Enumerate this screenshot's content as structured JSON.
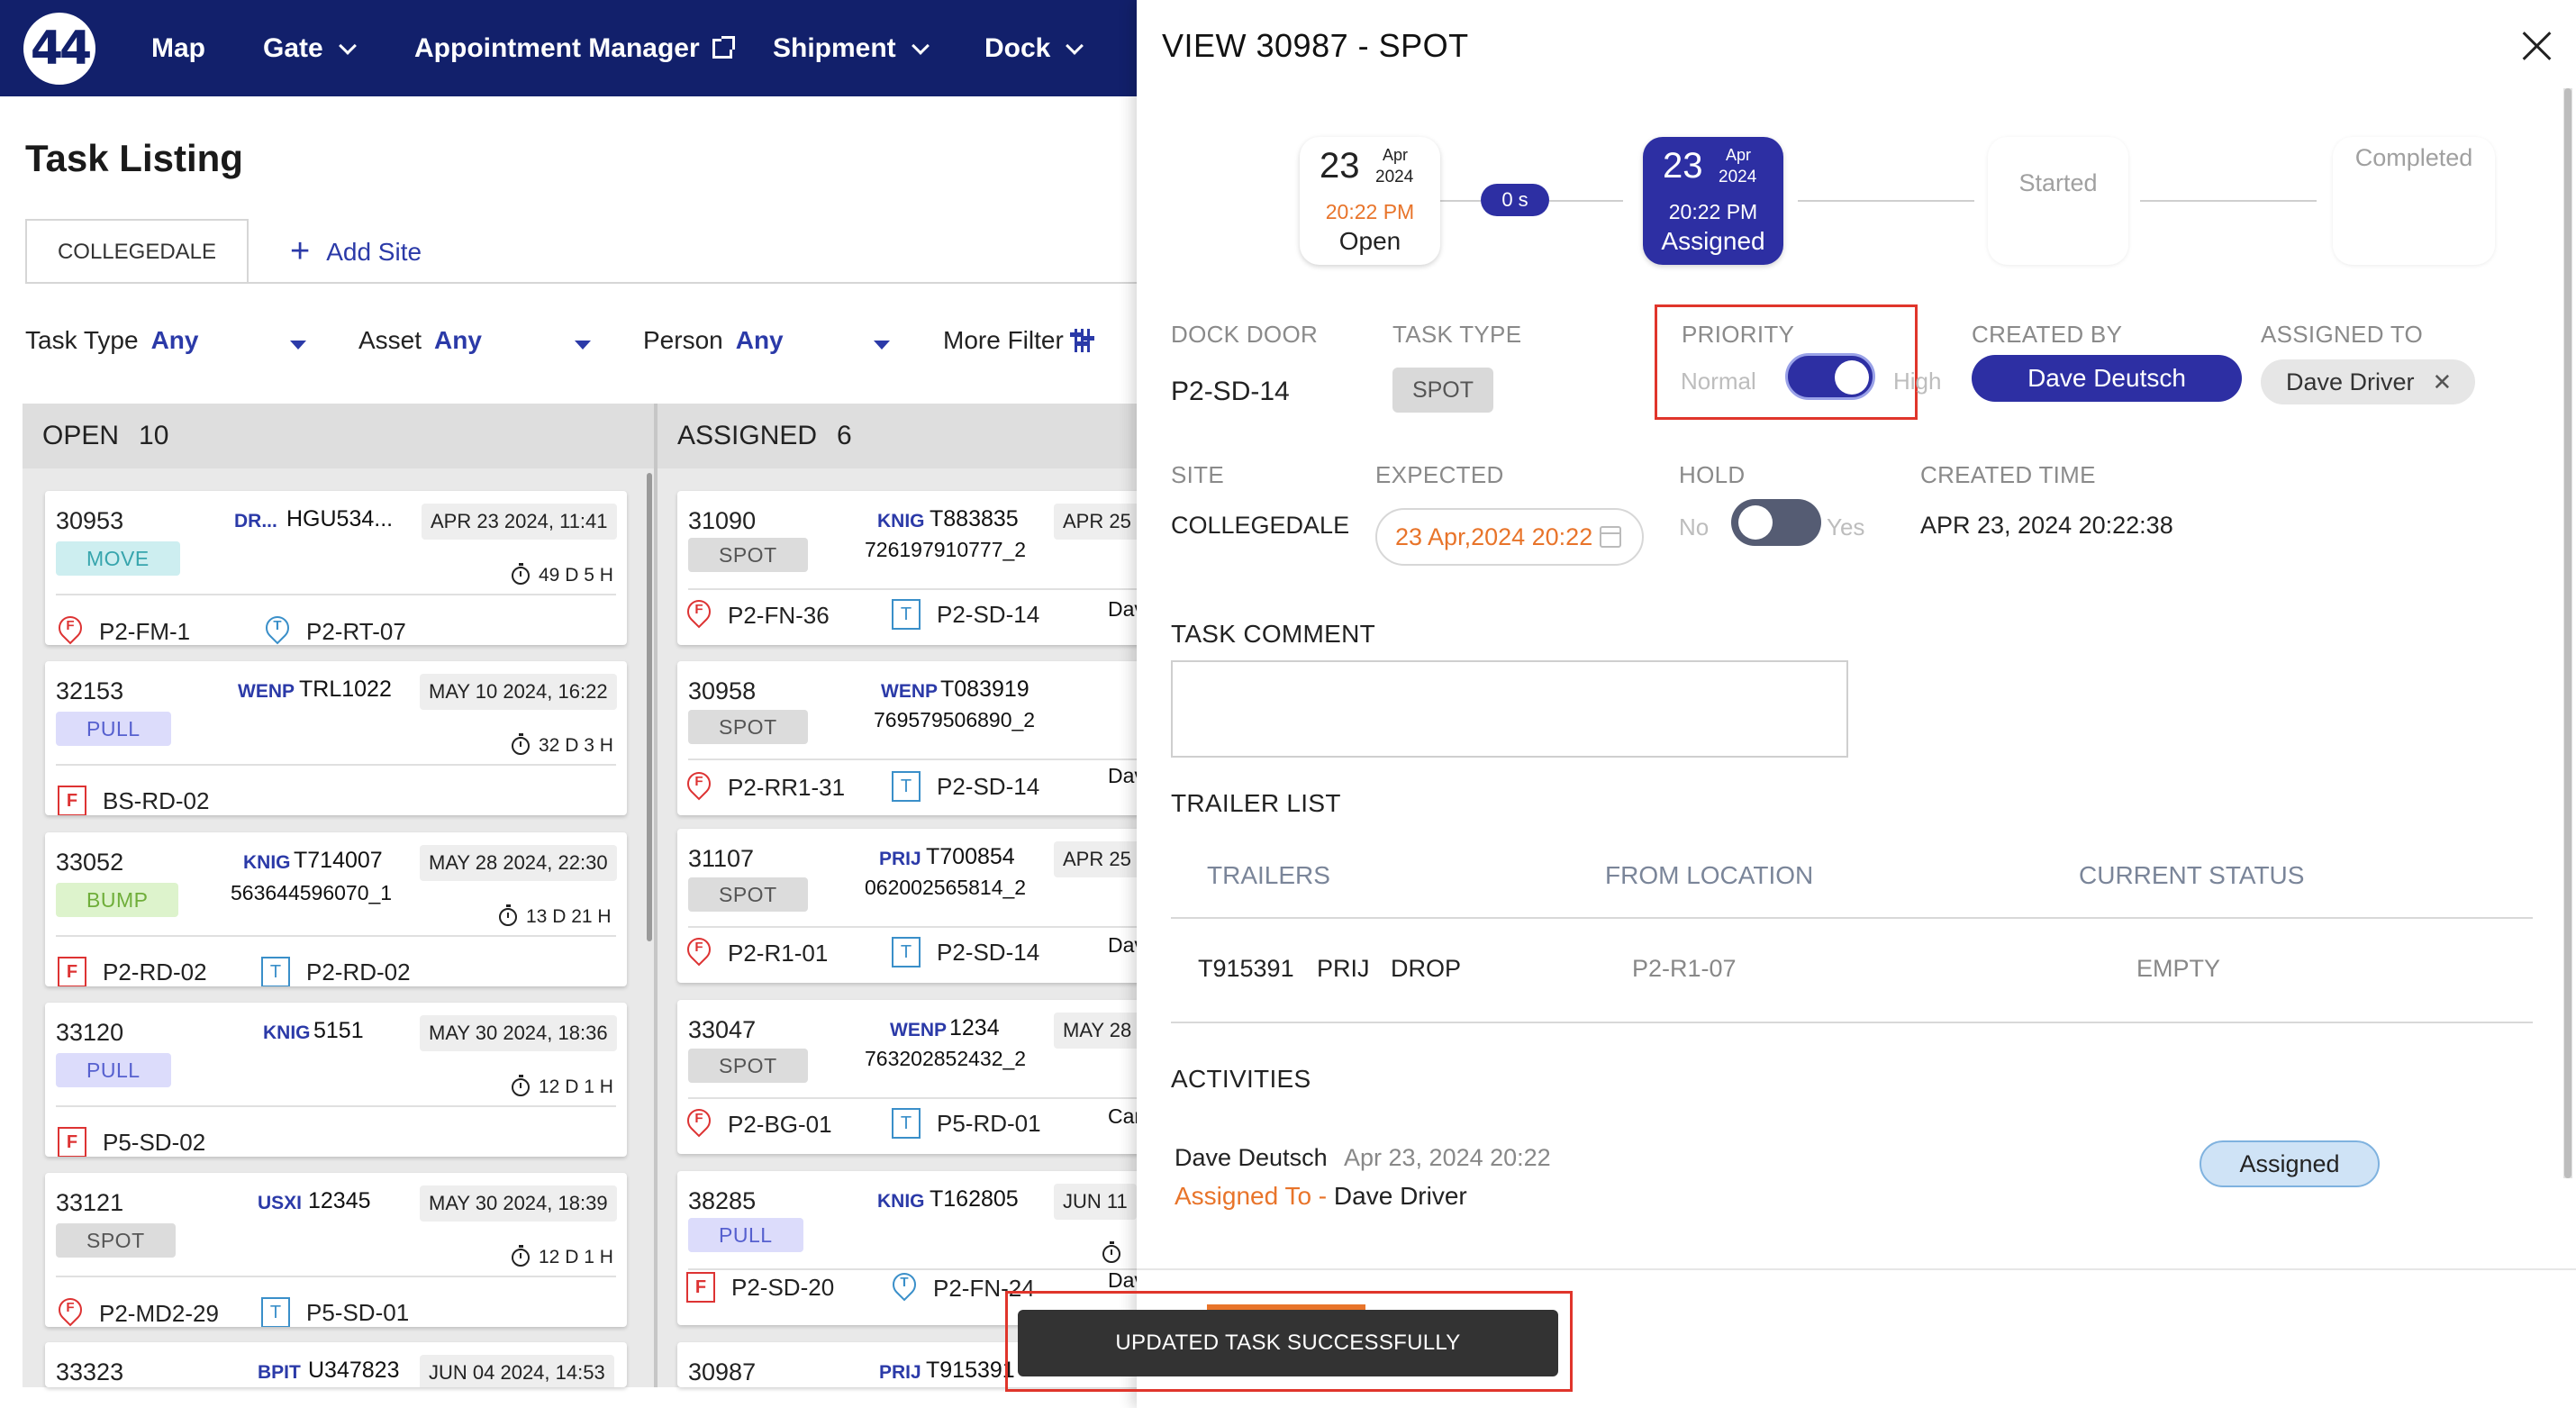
{
  "nav": {
    "logo_text": "44",
    "items": [
      {
        "label": "Map"
      },
      {
        "label": "Gate"
      },
      {
        "label": "Appointment Manager"
      },
      {
        "label": "Shipment"
      },
      {
        "label": "Dock"
      }
    ]
  },
  "page": {
    "title": "Task Listing",
    "site_tab": "COLLEGEDALE",
    "add_site": "Add Site",
    "filters": [
      {
        "label": "Task Type",
        "value": "Any"
      },
      {
        "label": "Asset",
        "value": "Any"
      },
      {
        "label": "Person",
        "value": "Any"
      }
    ],
    "more_filter": "More Filter"
  },
  "columns": {
    "open": {
      "title": "OPEN",
      "count": "10"
    },
    "assigned": {
      "title": "ASSIGNED",
      "count": "6"
    }
  },
  "open_cards": [
    {
      "id": "30953",
      "carrier": "DR...",
      "trailer": "HGU534...",
      "container": "",
      "date": "APR 23 2024, 11:41",
      "type": "MOVE",
      "elapsed": "49 D 5 H",
      "from": "P2-FM-1",
      "to": "P2-RT-07"
    },
    {
      "id": "32153",
      "carrier": "WENP",
      "trailer": "TRL1022",
      "container": "",
      "date": "MAY 10 2024, 16:22",
      "type": "PULL",
      "elapsed": "32 D 3 H",
      "from": "BS-RD-02",
      "to": ""
    },
    {
      "id": "33052",
      "carrier": "KNIG",
      "trailer": "T714007",
      "container": "563644596070_1",
      "date": "MAY 28 2024, 22:30",
      "type": "BUMP",
      "elapsed": "13 D 21 H",
      "from": "P2-RD-02",
      "to": "P2-RD-02"
    },
    {
      "id": "33120",
      "carrier": "KNIG",
      "trailer": "5151",
      "container": "",
      "date": "MAY 30 2024, 18:36",
      "type": "PULL",
      "elapsed": "12 D 1 H",
      "from": "P5-SD-02",
      "to": ""
    },
    {
      "id": "33121",
      "carrier": "USXI",
      "trailer": "12345",
      "container": "",
      "date": "MAY 30 2024, 18:39",
      "type": "SPOT",
      "elapsed": "12 D 1 H",
      "from": "P2-MD2-29",
      "to": "P5-SD-01"
    },
    {
      "id": "33323",
      "carrier": "BPIT",
      "trailer": "U347823",
      "container": "",
      "date": "JUN 04 2024, 14:53"
    }
  ],
  "assigned_cards": [
    {
      "id": "31090",
      "carrier": "KNIG",
      "trailer": "T883835",
      "container": "726197910777_2",
      "date": "APR 25",
      "type": "SPOT",
      "from": "P2-FN-36",
      "to": "P2-SD-14",
      "person": "Dav"
    },
    {
      "id": "30958",
      "carrier": "WENP",
      "trailer": "T083919",
      "container": "769579506890_2",
      "date": "",
      "type": "SPOT",
      "from": "P2-RR1-31",
      "to": "P2-SD-14",
      "person": "Dav"
    },
    {
      "id": "31107",
      "carrier": "PRIJ",
      "trailer": "T700854",
      "container": "062002565814_2",
      "date": "APR 25",
      "type": "SPOT",
      "from": "P2-R1-01",
      "to": "P2-SD-14",
      "person": "Dav"
    },
    {
      "id": "33047",
      "carrier": "WENP",
      "trailer": "1234",
      "container": "763202852432_2",
      "date": "MAY 28",
      "type": "SPOT",
      "from": "P2-BG-01",
      "to": "P5-RD-01",
      "person": "Car"
    },
    {
      "id": "38285",
      "carrier": "KNIG",
      "trailer": "T162805",
      "container": "",
      "date": "JUN 11",
      "type": "PULL",
      "from": "P2-SD-20",
      "to": "P2-FN-24",
      "person": "Dav"
    },
    {
      "id": "30987",
      "carrier": "PRIJ",
      "trailer": "T915391",
      "container": "",
      "date": ""
    }
  ],
  "panel": {
    "title": "VIEW 30987 - SPOT",
    "steps": [
      {
        "day": "23",
        "month": "Apr",
        "year": "2024",
        "time": "20:22 PM",
        "label": "Open"
      },
      {
        "day": "23",
        "month": "Apr",
        "year": "2024",
        "time": "20:22 PM",
        "label": "Assigned"
      },
      {
        "label": "Started"
      },
      {
        "label": "Completed"
      }
    ],
    "duration": "0 s",
    "fields": {
      "dock_door_label": "DOCK DOOR",
      "dock_door": "P2-SD-14",
      "task_type_label": "TASK TYPE",
      "task_type": "SPOT",
      "priority_label": "PRIORITY",
      "priority_off": "Normal",
      "priority_on": "High",
      "created_by_label": "CREATED BY",
      "created_by": "Dave Deutsch",
      "assigned_to_label": "ASSIGNED TO",
      "assigned_to": "Dave Driver",
      "site_label": "SITE",
      "site": "COLLEGEDALE",
      "expected_label": "EXPECTED",
      "expected": "23 Apr,2024 20:22",
      "hold_label": "HOLD",
      "hold_off": "No",
      "hold_on": "Yes",
      "created_time_label": "CREATED TIME",
      "created_time": "APR 23, 2024 20:22:38"
    },
    "task_comment_label": "TASK COMMENT",
    "trailer_list_label": "TRAILER LIST",
    "trailer_columns": [
      "TRAILERS",
      "FROM LOCATION",
      "CURRENT STATUS"
    ],
    "trailers": [
      {
        "trailer": "T915391",
        "carrier": "PRIJ",
        "kind": "DROP",
        "from": "P2-R1-07",
        "status": "EMPTY"
      }
    ],
    "activities_label": "ACTIVITIES",
    "activities": [
      {
        "user": "Dave Deutsch",
        "date": "Apr 23, 2024 20:22",
        "action": "Assigned To - ",
        "target": "Dave Driver",
        "status": "Assigned"
      }
    ]
  },
  "toast": {
    "message": "UPDATED TASK SUCCESSFULLY"
  },
  "colors": {
    "nav": "#12206b",
    "accent": "#2d2fa3",
    "highlight": "#e0352b",
    "orange": "#e8742a"
  }
}
